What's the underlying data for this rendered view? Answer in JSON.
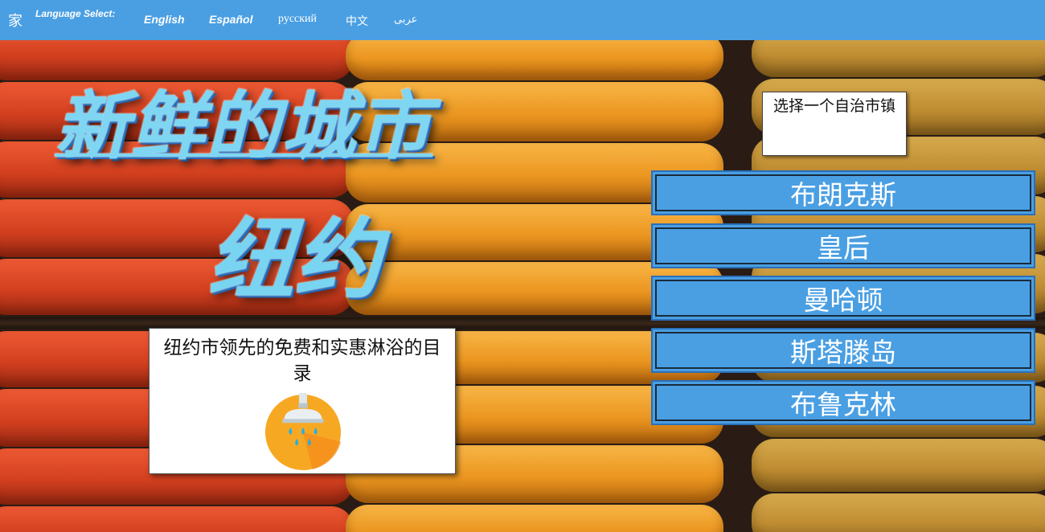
{
  "nav": {
    "home_label": "家",
    "language_label": "Language Select:",
    "languages": [
      "English",
      "Español",
      "русский",
      "中文",
      "عربى"
    ]
  },
  "hero": {
    "title": "新鲜的城市",
    "subtitle": "纽约"
  },
  "directory": {
    "text": "纽约市领先的免费和实惠淋浴的目录",
    "icon": "shower-icon"
  },
  "borough_select": {
    "label": "选择一个自治市镇",
    "boroughs": [
      "布朗克斯",
      "皇后",
      "曼哈顿",
      "斯塔滕岛",
      "布鲁克林"
    ]
  },
  "colors": {
    "nav_blue": "#4a9fe3",
    "title_cyan": "#7fd6f2",
    "button_border": "#2b6fb8"
  }
}
